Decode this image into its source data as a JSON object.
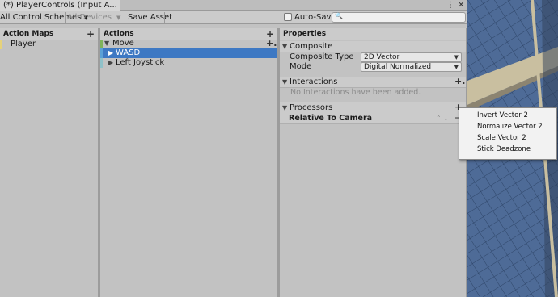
{
  "window": {
    "title": "(*) PlayerControls (Input A..."
  },
  "toolbar": {
    "control_schemes": "All Control Schemes",
    "devices": "All Devices",
    "save_asset": "Save Asset",
    "auto_save": "Auto-Save",
    "search_placeholder": ""
  },
  "action_maps": {
    "header": "Action Maps",
    "items": [
      "Player"
    ]
  },
  "actions": {
    "header": "Actions",
    "action": "Move",
    "bindings": [
      "WASD",
      "Left Joystick"
    ]
  },
  "properties": {
    "header": "Properties",
    "composite": {
      "title": "Composite",
      "type_label": "Composite Type",
      "type_value": "2D Vector",
      "mode_label": "Mode",
      "mode_value": "Digital Normalized"
    },
    "interactions": {
      "title": "Interactions",
      "empty_text": "No Interactions have been added."
    },
    "processors": {
      "title": "Processors",
      "item": "Relative To Camera"
    }
  },
  "processor_menu": {
    "items": [
      "Invert Vector 2",
      "Normalize Vector 2",
      "Scale Vector 2",
      "Stick Deadzone"
    ]
  },
  "colors": {
    "selection": "#3d78c3",
    "scene_blue": "#4e6b97",
    "scene_beige": "#c9bfa0"
  }
}
